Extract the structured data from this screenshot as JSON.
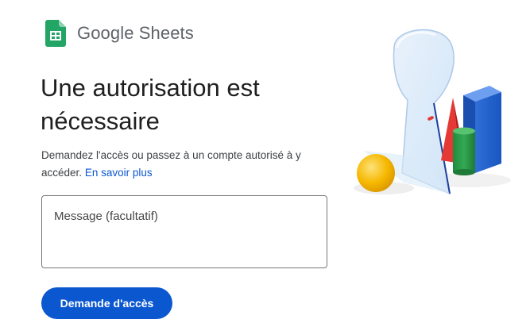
{
  "brand": {
    "google_word": "Google",
    "product_word": "Sheets",
    "logo_icon": "google-sheets-logo-icon"
  },
  "main": {
    "heading": "Une autorisation est nécessaire",
    "description": "Demandez l'accès ou passez à un compte autorisé à y accéder.",
    "learn_more_link": "En savoir plus"
  },
  "message_field": {
    "value": "",
    "placeholder": "Message (facultatif)"
  },
  "request_button": {
    "label": "Demande d'accès"
  },
  "colors": {
    "primary_button": "#0b57d0",
    "link": "#0b57d0",
    "sheets_green": "#23a566"
  },
  "illustration": {
    "icon": "keyhole-with-shapes-illustration"
  }
}
